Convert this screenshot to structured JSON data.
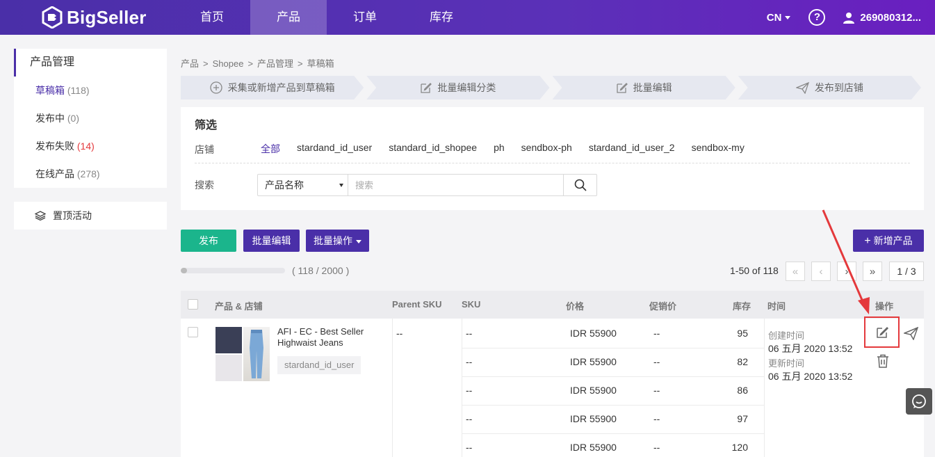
{
  "brand": {
    "name": "BigSeller"
  },
  "nav": {
    "items": [
      "首页",
      "产品",
      "订单",
      "库存"
    ],
    "active_index": 1
  },
  "topbar": {
    "lang": "CN",
    "help": "?",
    "user": "269080312..."
  },
  "sidebar": {
    "header": "产品管理",
    "items": [
      {
        "label": "草稿箱",
        "count": "(118)"
      },
      {
        "label": "发布中",
        "count": "(0)"
      },
      {
        "label": "发布失败",
        "count": "(14)"
      },
      {
        "label": "在线产品",
        "count": "(278)"
      }
    ],
    "pinned": "置顶活动"
  },
  "breadcrumb": [
    "产品",
    "Shopee",
    "产品管理",
    "草稿箱"
  ],
  "steps": [
    "采集或新增产品到草稿箱",
    "批量编辑分类",
    "批量编辑",
    "发布到店铺"
  ],
  "filter": {
    "title": "筛选",
    "store_label": "店铺",
    "stores": [
      "全部",
      "stardand_id_user",
      "standard_id_shopee",
      "ph",
      "sendbox-ph",
      "stardand_id_user_2",
      "sendbox-my"
    ],
    "search_label": "搜索",
    "search_type": "产品名称",
    "search_placeholder": "搜索"
  },
  "actions": {
    "publish": "发布",
    "batch_edit": "批量编辑",
    "batch_ops": "批量操作",
    "add_product": "新增产品"
  },
  "quota": {
    "text": "( 118 / 2000 )",
    "fraction": 0.059
  },
  "pagination": {
    "range": "1-50 of 118",
    "page": "1 / 3"
  },
  "table": {
    "headers": [
      "产品 & 店铺",
      "Parent SKU",
      "SKU",
      "价格",
      "促销价",
      "库存",
      "时间",
      "操作"
    ],
    "row": {
      "name": "AFI - EC - Best Seller Highwaist Jeans",
      "store": "stardand_id_user",
      "parent_sku": "--",
      "variants": [
        {
          "sku": "--",
          "price": "IDR 55900",
          "promo": "--",
          "stock": "95"
        },
        {
          "sku": "--",
          "price": "IDR 55900",
          "promo": "--",
          "stock": "82"
        },
        {
          "sku": "--",
          "price": "IDR 55900",
          "promo": "--",
          "stock": "86"
        },
        {
          "sku": "--",
          "price": "IDR 55900",
          "promo": "--",
          "stock": "97"
        },
        {
          "sku": "--",
          "price": "IDR 55900",
          "promo": "--",
          "stock": "120"
        }
      ],
      "created_label": "创建时间",
      "created": "06 五月 2020 13:52",
      "updated_label": "更新时间",
      "updated": "06 五月 2020 13:52"
    }
  },
  "colors": {
    "primary": "#4a2fa8",
    "green": "#1bb58c",
    "danger": "#e4393c"
  }
}
